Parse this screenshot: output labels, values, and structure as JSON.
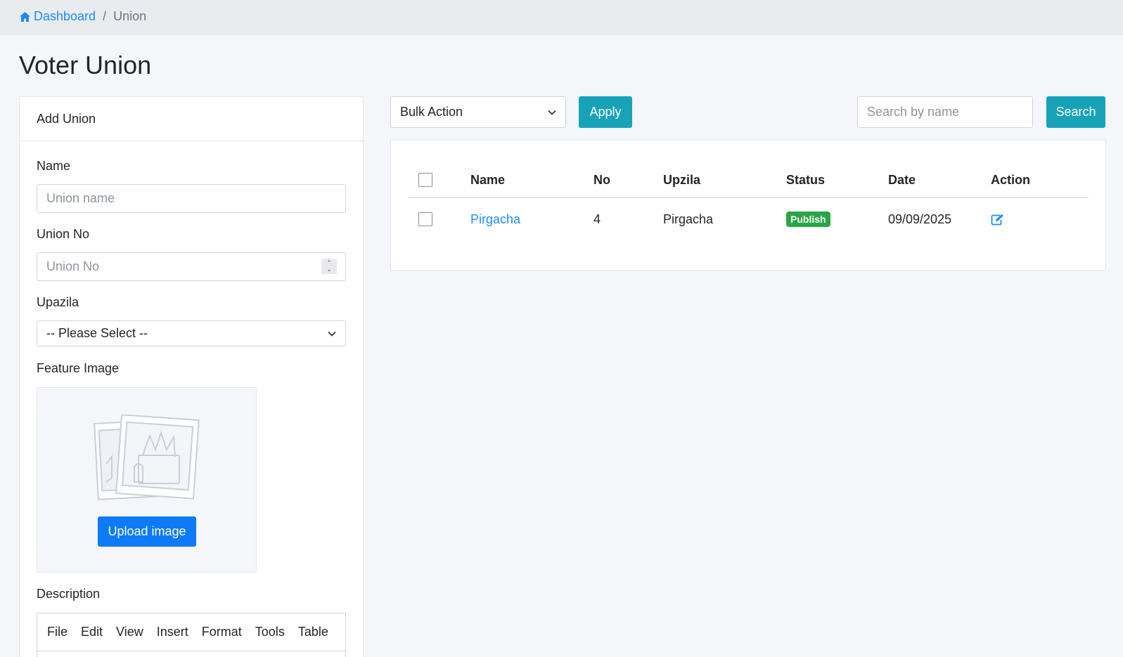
{
  "breadcrumb": {
    "home": "Dashboard",
    "separator": "/",
    "current": "Union"
  },
  "page_title": "Voter Union",
  "add_form": {
    "header": "Add Union",
    "name_label": "Name",
    "name_placeholder": "Union name",
    "union_no_label": "Union No",
    "union_no_placeholder": "Union No",
    "upazila_label": "Upazila",
    "upazila_value": "-- Please Select --",
    "feature_image_label": "Feature Image",
    "upload_button": "Upload image",
    "description_label": "Description",
    "editor_menu": [
      "File",
      "Edit",
      "View",
      "Insert",
      "Format",
      "Tools",
      "Table"
    ]
  },
  "toolbar": {
    "bulk_action": "Bulk Action",
    "apply": "Apply",
    "search_placeholder": "Search by name",
    "search": "Search"
  },
  "table": {
    "columns": [
      "Name",
      "No",
      "Upzila",
      "Status",
      "Date",
      "Action"
    ],
    "rows": [
      {
        "name": "Pirgacha",
        "no": "4",
        "upzila": "Pirgacha",
        "status": "Publish",
        "date": "09/09/2025"
      }
    ]
  },
  "colors": {
    "accent": "#1a8cff",
    "teal": "#17a2b8",
    "primary": "#0d7bf7",
    "success": "#28a745"
  }
}
